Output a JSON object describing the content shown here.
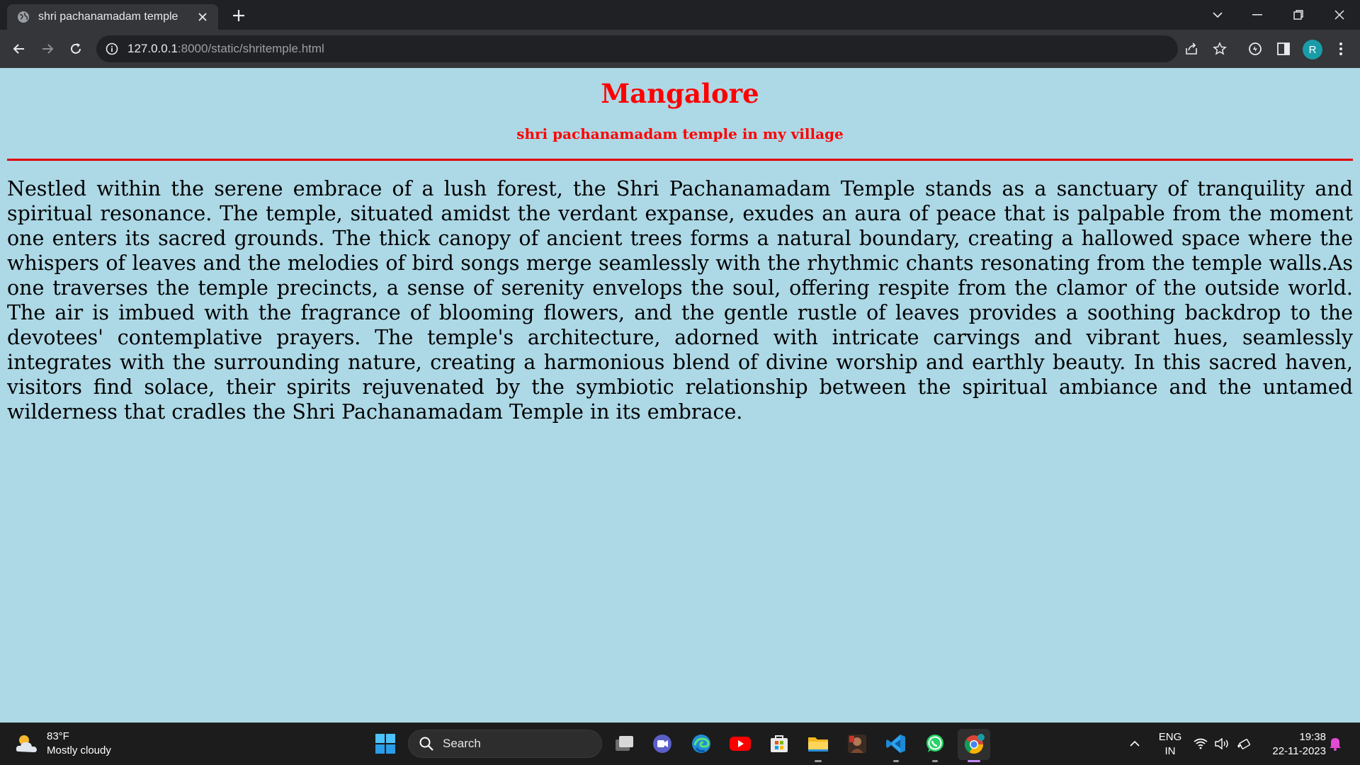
{
  "browser": {
    "tab_title": "shri pachanamadam temple",
    "url_host": "127.0.0.1",
    "url_rest": ":8000/static/shritemple.html",
    "profile_initial": "R",
    "profile_color": "#1a9ba8"
  },
  "page": {
    "heading": "Mangalore",
    "subheading": "shri pachanamadam temple in my village",
    "paragraph": "Nestled within the serene embrace of a lush forest, the Shri Pachanamadam Temple stands as a sanctuary of tranquility and spiritual resonance. The temple, situated amidst the verdant expanse, exudes an aura of peace that is palpable from the moment one enters its sacred grounds. The thick canopy of ancient trees forms a natural boundary, creating a hallowed space where the whispers of leaves and the melodies of bird songs merge seamlessly with the rhythmic chants resonating from the temple walls.As one traverses the temple precincts, a sense of serenity envelops the soul, offering respite from the clamor of the outside world. The air is imbued with the fragrance of blooming flowers, and the gentle rustle of leaves provides a soothing backdrop to the devotees' contemplative prayers. The temple's architecture, adorned with intricate carvings and vibrant hues, seamlessly integrates with the surrounding nature, creating a harmonious blend of divine worship and earthly beauty. In this sacred haven, visitors find solace, their spirits rejuvenated by the symbiotic relationship between the spiritual ambiance and the untamed wilderness that cradles the Shri Pachanamadam Temple in its embrace.",
    "background_color": "#add8e6",
    "heading_color": "#ff0000"
  },
  "taskbar": {
    "weather_temp": "83°F",
    "weather_desc": "Mostly cloudy",
    "search_label": "Search",
    "language": "ENG",
    "region": "IN",
    "time": "19:38",
    "date": "22-11-2023",
    "apps": [
      "task-view",
      "teams",
      "edge",
      "youtube",
      "store",
      "file-explorer",
      "photo-app",
      "vscode",
      "whatsapp",
      "chrome"
    ]
  }
}
